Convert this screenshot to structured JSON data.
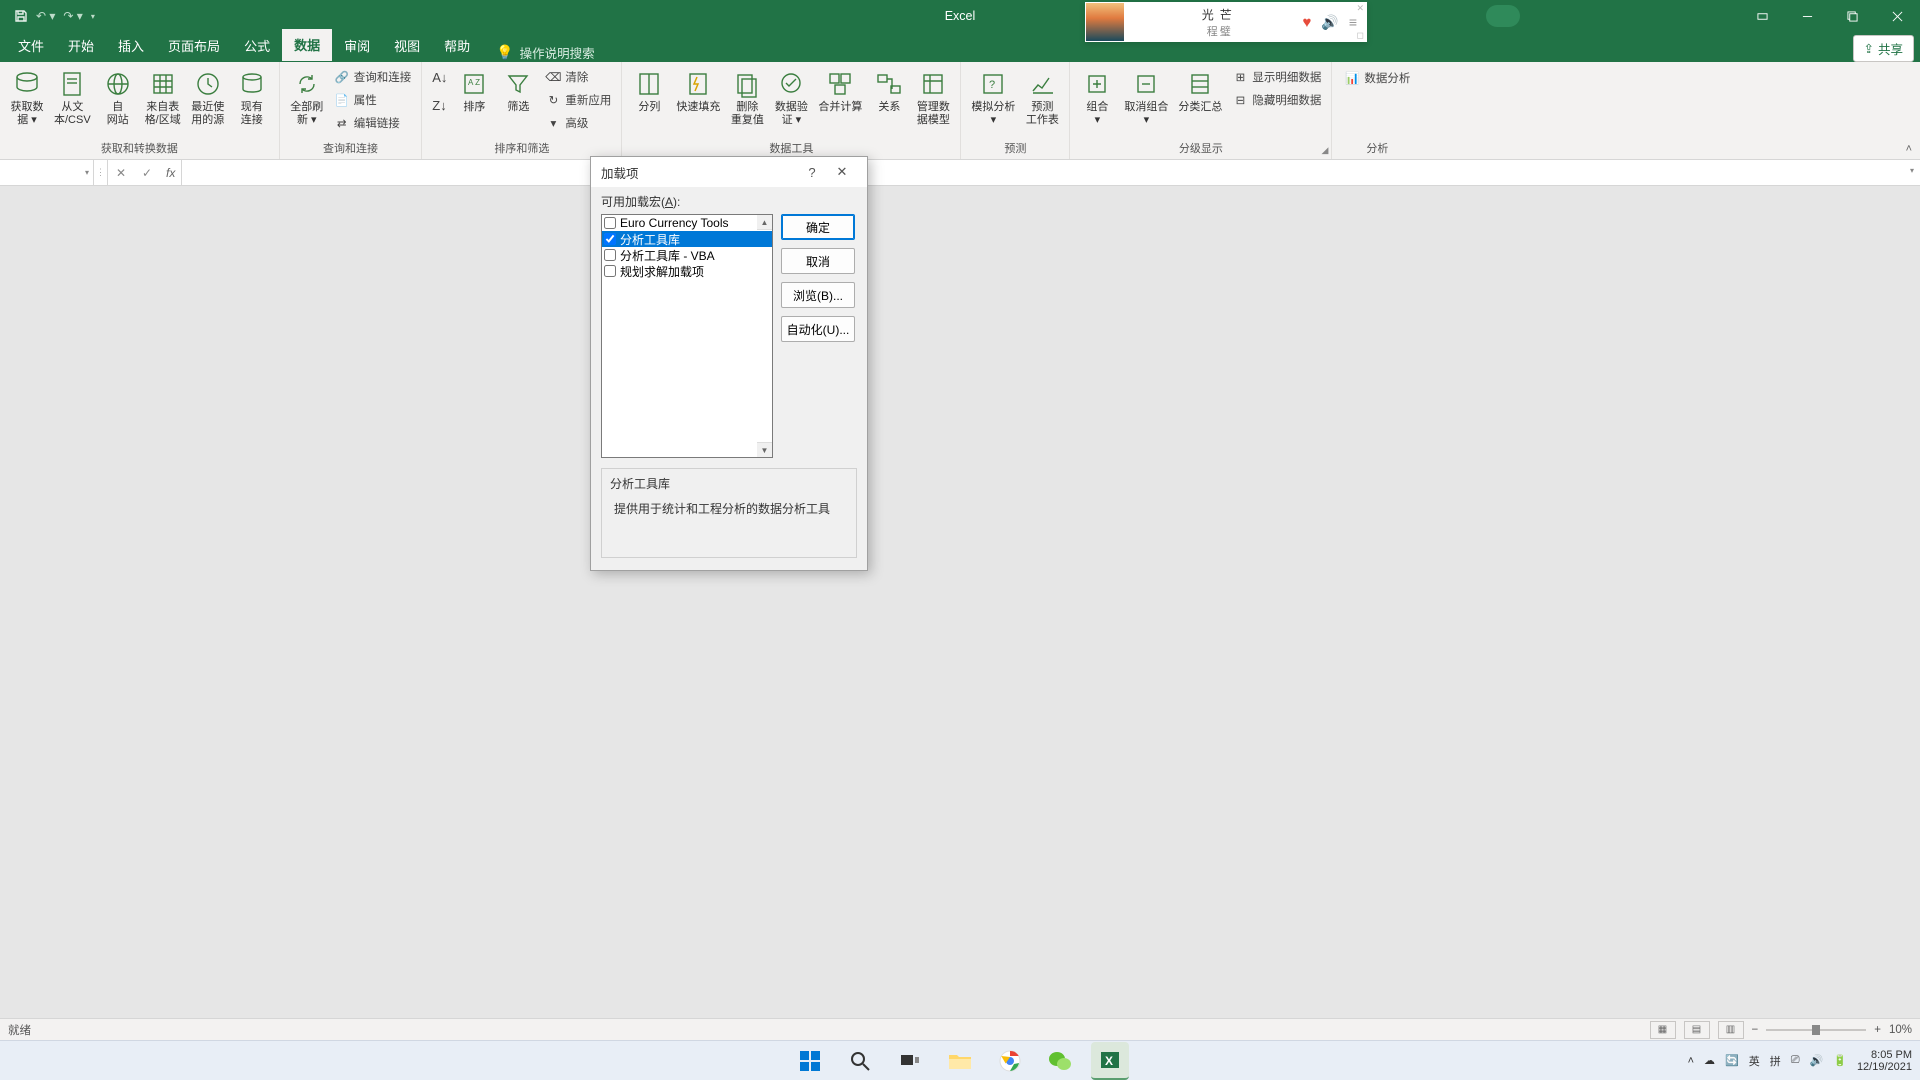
{
  "app_title": "Excel",
  "music": {
    "track": "光芒",
    "artist": "程璧"
  },
  "tabs": {
    "file": "文件",
    "home": "开始",
    "insert": "插入",
    "layout": "页面布局",
    "formulas": "公式",
    "data": "数据",
    "review": "审阅",
    "view": "视图",
    "help": "帮助",
    "tell_me": "操作说明搜索"
  },
  "share_label": "共享",
  "ribbon": {
    "g1": {
      "label": "获取和转换数据",
      "b1": "获取数\n据 ▾",
      "b2": "从文\n本/CSV",
      "b3": "自\n网站",
      "b4": "来自表\n格/区域",
      "b5": "最近使\n用的源",
      "b6": "现有\n连接"
    },
    "g2": {
      "label": "查询和连接",
      "b1": "全部刷\n新 ▾",
      "s1": "查询和连接",
      "s2": "属性",
      "s3": "编辑链接"
    },
    "g3": {
      "label": "排序和筛选",
      "b1": "排序",
      "b2": "筛选",
      "s1": "清除",
      "s2": "重新应用",
      "s3": "高级"
    },
    "g4": {
      "label": "数据工具",
      "b1": "分列",
      "b2": "快速填充",
      "b3": "删除\n重复值",
      "b4": "数据验\n证 ▾",
      "b5": "合并计算",
      "b6": "关系",
      "b7": "管理数\n据模型"
    },
    "g5": {
      "label": "预测",
      "b1": "模拟分析\n▾",
      "b2": "预测\n工作表"
    },
    "g6": {
      "label": "分级显示",
      "b1": "组合\n▾",
      "b2": "取消组合\n▾",
      "b3": "分类汇总",
      "s1": "显示明细数据",
      "s2": "隐藏明细数据"
    },
    "g7": {
      "label": "分析",
      "b1": "数据分析"
    }
  },
  "status": {
    "ready": "就绪",
    "zoom": "10%"
  },
  "dialog": {
    "title": "加载项",
    "available_label": "可用加载宏(",
    "available_key": "A",
    "available_suffix": "):",
    "items": {
      "i0": "Euro Currency Tools",
      "i1": "分析工具库",
      "i2": "分析工具库 - VBA",
      "i3": "规划求解加载项"
    },
    "ok": "确定",
    "cancel": "取消",
    "browse": "浏览(B)...",
    "automation": "自动化(U)...",
    "desc_title": "分析工具库",
    "desc_body": "提供用于统计和工程分析的数据分析工具"
  },
  "taskbar": {
    "ime1": "英",
    "ime2": "拼",
    "time": "8:05 PM",
    "date": "12/19/2021"
  }
}
